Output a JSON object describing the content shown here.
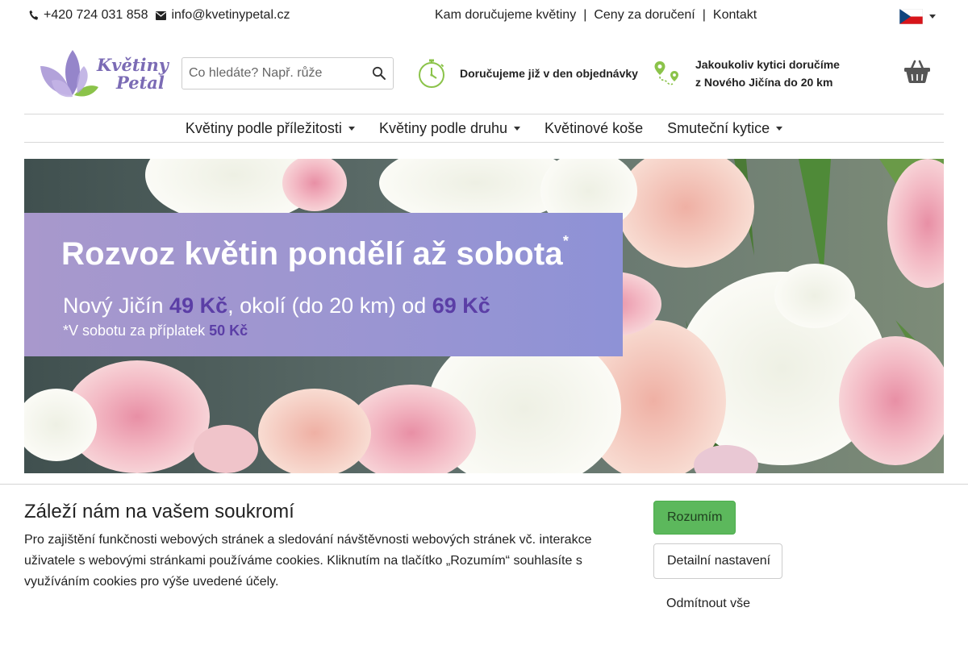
{
  "topbar": {
    "phone": "+420 724 031 858",
    "email": "info@kvetinypetal.cz",
    "links": [
      "Kam doručujeme květiny",
      "Ceny za doručení",
      "Kontakt"
    ],
    "separator": "|"
  },
  "logo": {
    "line1": "Květiny",
    "line2": "Petal"
  },
  "search": {
    "placeholder": "Co hledáte? Např. růže",
    "value": ""
  },
  "features": {
    "delivery_same_day": "Doručujeme již v den objednávky",
    "delivery_area_line1": "Jakoukoliv kytici doručíme",
    "delivery_area_line2": "z Nového Jičína do 20 km"
  },
  "nav": {
    "items": [
      {
        "label": "Květiny podle příležitosti",
        "dropdown": true
      },
      {
        "label": "Květiny podle druhu",
        "dropdown": true
      },
      {
        "label": "Květinové koše",
        "dropdown": false
      },
      {
        "label": "Smuteční kytice",
        "dropdown": true
      }
    ]
  },
  "banner": {
    "headline": "Rozvoz květin pondělí až sobota",
    "headline_mark": "*",
    "line2_a": "Nový Jičín ",
    "line2_price1": "49 Kč",
    "line2_b": ", okolí (do 20 km) od ",
    "line2_price2": "69 Kč",
    "line3_a": "*V sobotu za příplatek ",
    "line3_price": "50 Kč"
  },
  "cookie": {
    "title": "Záleží nám na vašem soukromí",
    "text": "Pro zajištění funkčnosti webových stránek a sledování návštěvnosti webových stránek vč. interakce uživatele s webovými stránkami používáme cookies. Kliknutím na tlačítko „Rozumím“ souhlasíte s využíváním cookies pro výše uvedené účely.",
    "accept": "Rozumím",
    "details": "Detailní nastavení",
    "reject": "Odmítnout vše"
  },
  "colors": {
    "brand_purple": "#7b6bb5",
    "accent_green": "#8bc34a",
    "accept_button": "#5cb85c"
  }
}
